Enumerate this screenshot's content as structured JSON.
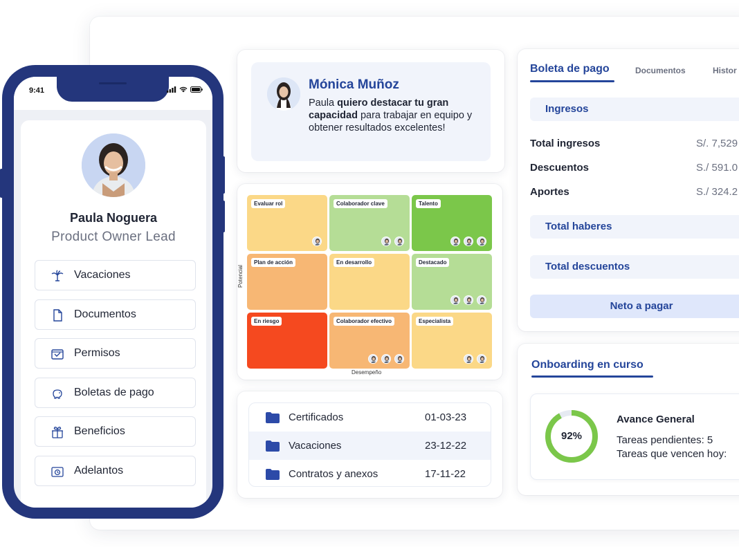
{
  "recognition": {
    "name": "Mónica Muñoz",
    "msg_part1": "Paula ",
    "msg_bold": "quiero destacar tu gran capacidad",
    "msg_part2": " para trabajar en equipo y obtener resultados excelentes!"
  },
  "ninebox": {
    "y_axis": "Potencial",
    "x_axis": "Desempeño",
    "cells": [
      {
        "label": "Evaluar rol",
        "color": "#fbd887",
        "avatars": 1
      },
      {
        "label": "Colaborador clave",
        "color": "#b5dd96",
        "avatars": 2
      },
      {
        "label": "Talento",
        "color": "#7bc74a",
        "avatars": 3
      },
      {
        "label": "Plan de acción",
        "color": "#f7b774",
        "avatars": 0
      },
      {
        "label": "En desarrollo",
        "color": "#fbd887",
        "avatars": 0
      },
      {
        "label": "Destacado",
        "color": "#b5dd96",
        "avatars": 3
      },
      {
        "label": "En riesgo",
        "color": "#f5491f",
        "avatars": 0
      },
      {
        "label": "Colaborador efectivo",
        "color": "#f7b774",
        "avatars": 3
      },
      {
        "label": "Especialista",
        "color": "#fbd887",
        "avatars": 2
      }
    ]
  },
  "documents": [
    {
      "name": "Certificados",
      "date": "01-03-23"
    },
    {
      "name": "Vacaciones",
      "date": "23-12-22"
    },
    {
      "name": "Contratos y anexos",
      "date": "17-11-22"
    }
  ],
  "payroll": {
    "tabs": [
      "Boleta de pago",
      "Documentos",
      "Histor"
    ],
    "ingresos": "Ingresos",
    "rows": [
      {
        "label": "Total ingresos",
        "value": "S/. 7,529"
      },
      {
        "label": "Descuentos",
        "value": "S./ 591.0"
      },
      {
        "label": "Aportes",
        "value": "S./ 324.2"
      }
    ],
    "total_haberes": "Total haberes",
    "total_descuentos": "Total descuentos",
    "neto": "Neto a pagar"
  },
  "onboarding": {
    "title": "Onboarding en curso",
    "progress_label": "92%",
    "progress": 0.92,
    "heading": "Avance General",
    "line1": "Tareas pendientes: 5",
    "line2": "Tareas que vencen hoy:"
  },
  "phone": {
    "time": "9:41",
    "user_name": "Paula Noguera",
    "user_role": "Product Owner Lead",
    "menu": [
      {
        "label": "Vacaciones",
        "icon": "palm-tree-icon"
      },
      {
        "label": "Documentos",
        "icon": "document-icon"
      },
      {
        "label": "Permisos",
        "icon": "calendar-check-icon"
      },
      {
        "label": "Boletas de pago",
        "icon": "piggy-bank-icon"
      },
      {
        "label": "Beneficios",
        "icon": "gift-icon"
      },
      {
        "label": "Adelantos",
        "icon": "cash-clock-icon"
      }
    ],
    "accent": "#24367c"
  }
}
